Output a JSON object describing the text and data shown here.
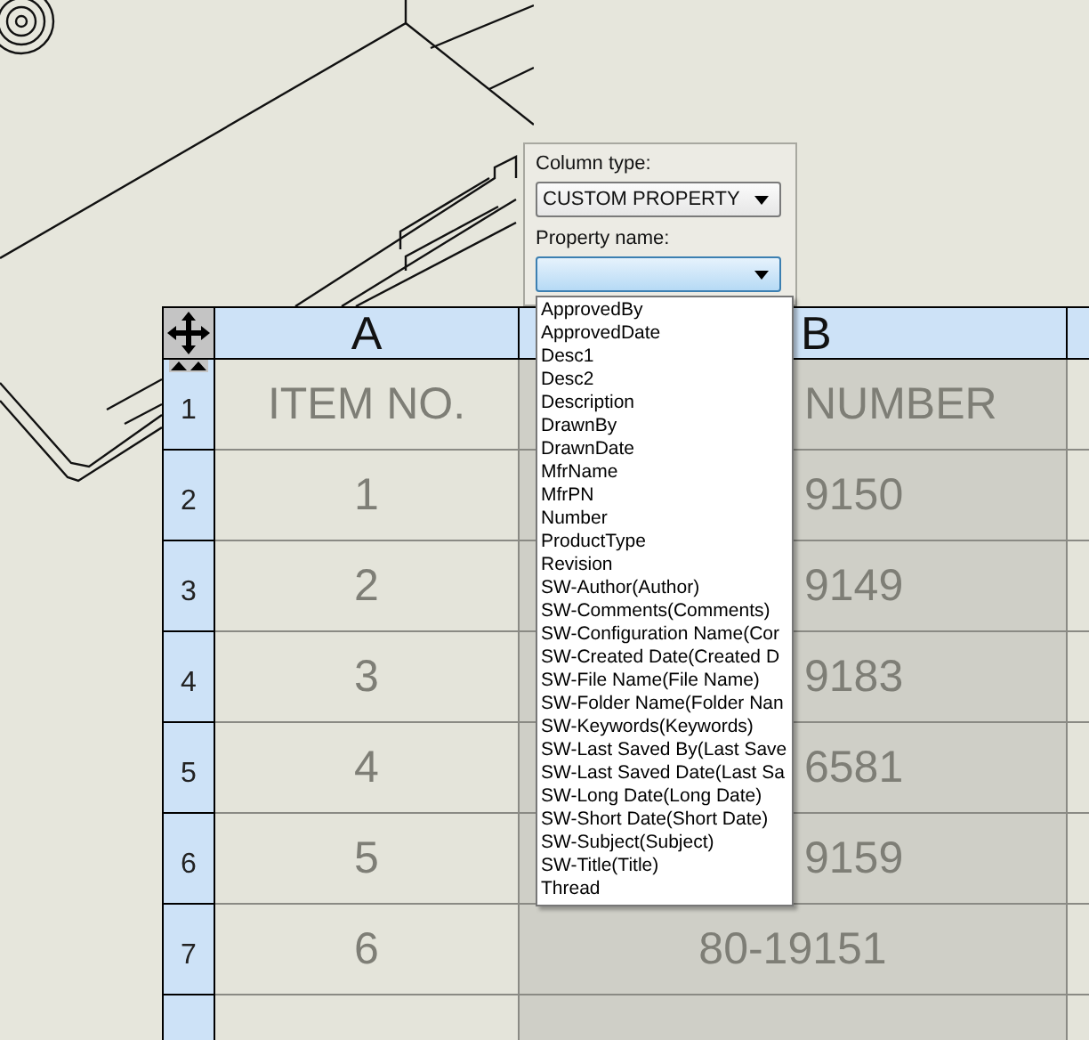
{
  "column_panel": {
    "column_type_label": "Column type:",
    "column_type_value": "CUSTOM PROPERTY",
    "property_name_label": "Property name:",
    "property_options": [
      "ApprovedBy",
      "ApprovedDate",
      "Desc1",
      "Desc2",
      "Description",
      "DrawnBy",
      "DrawnDate",
      "MfrName",
      "MfrPN",
      "Number",
      "ProductType",
      "Revision",
      "SW-Author(Author)",
      "SW-Comments(Comments)",
      "SW-Configuration Name(Cor",
      "SW-Created Date(Created D",
      "SW-File Name(File Name)",
      "SW-Folder Name(Folder Nan",
      "SW-Keywords(Keywords)",
      "SW-Last Saved By(Last Save",
      "SW-Last Saved Date(Last Sa",
      "SW-Long Date(Long Date)",
      "SW-Short Date(Short Date)",
      "SW-Subject(Subject)",
      "SW-Title(Title)",
      "Thread"
    ]
  },
  "table": {
    "columns": [
      "A",
      "B"
    ],
    "rows": [
      {
        "number": "1",
        "cells": [
          "ITEM NO.",
          "NUMBER"
        ]
      },
      {
        "number": "2",
        "cells": [
          "1",
          "9150"
        ]
      },
      {
        "number": "3",
        "cells": [
          "2",
          "9149"
        ]
      },
      {
        "number": "4",
        "cells": [
          "3",
          "9183"
        ]
      },
      {
        "number": "5",
        "cells": [
          "4",
          "6581"
        ]
      },
      {
        "number": "6",
        "cells": [
          "5",
          "9159"
        ]
      },
      {
        "number": "7",
        "cells": [
          "6",
          "80-19151"
        ]
      }
    ]
  }
}
